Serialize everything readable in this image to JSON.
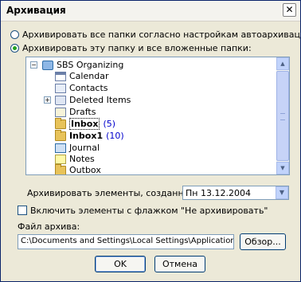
{
  "window": {
    "title": "Архивация",
    "close_glyph": "✕"
  },
  "options": {
    "archive_all": "Архивировать все папки согласно настройкам автоархивации",
    "archive_this": "Архивировать эту папку и все вложенные папки:"
  },
  "tree": {
    "root_expander": "−",
    "expander_plus": "+",
    "root": {
      "label": "SBS Organizing",
      "icon": "pst-file-icon"
    },
    "items": [
      {
        "label": "Calendar",
        "icon": "calendar-icon"
      },
      {
        "label": "Contacts",
        "icon": "contacts-icon"
      },
      {
        "label": "Deleted Items",
        "icon": "deleted-items-icon",
        "expandable": true
      },
      {
        "label": "Drafts",
        "icon": "drafts-icon"
      },
      {
        "label": "Inbox",
        "icon": "folder-icon",
        "count": "(5)",
        "bold": true,
        "selected": true
      },
      {
        "label": "Inbox1",
        "icon": "folder-icon",
        "count": "(10)",
        "bold": true
      },
      {
        "label": "Journal",
        "icon": "journal-icon"
      },
      {
        "label": "Notes",
        "icon": "notes-icon"
      },
      {
        "label": "Outbox",
        "icon": "folder-icon"
      }
    ],
    "scroll_up": "▲",
    "scroll_down": "▼"
  },
  "older_than": {
    "label": "Архивировать элементы, созданные до:",
    "value": "Пн 13.12.2004",
    "drop_glyph": "▼"
  },
  "include_checkbox": {
    "label": "Включить элементы с флажком \"Не архивировать\"",
    "checked": false
  },
  "archive_file": {
    "label": "Файл архива:",
    "value": "C:\\Documents and Settings\\Local Settings\\Application Data\\M",
    "browse": "Обзор..."
  },
  "buttons": {
    "ok": "OK",
    "cancel": "Отмена"
  }
}
